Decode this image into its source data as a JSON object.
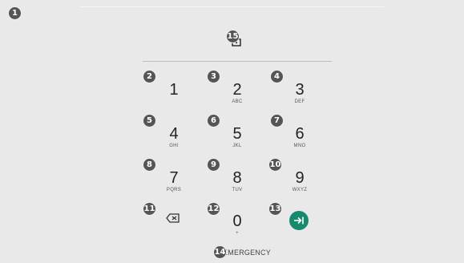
{
  "markers": [
    "1",
    "2",
    "3",
    "4",
    "5",
    "6",
    "7",
    "8",
    "9",
    "10",
    "11",
    "12",
    "13",
    "14",
    "15"
  ],
  "keypad": [
    {
      "digit": "1",
      "letters": ""
    },
    {
      "digit": "2",
      "letters": "ABC"
    },
    {
      "digit": "3",
      "letters": "DEF"
    },
    {
      "digit": "4",
      "letters": "GHI"
    },
    {
      "digit": "5",
      "letters": "JKL"
    },
    {
      "digit": "6",
      "letters": "MNO"
    },
    {
      "digit": "7",
      "letters": "PQRS"
    },
    {
      "digit": "8",
      "letters": "TUV"
    },
    {
      "digit": "9",
      "letters": "WXYZ"
    },
    {
      "digit": "0",
      "letters": "+"
    }
  ],
  "emergency_label": "EMERGENCY",
  "icons": {
    "backspace": "backspace-icon",
    "enter": "enter-arrow-icon",
    "pin": "lock-icon"
  },
  "colors": {
    "background": "#e9e9e9",
    "enter_button": "#178a6d"
  }
}
